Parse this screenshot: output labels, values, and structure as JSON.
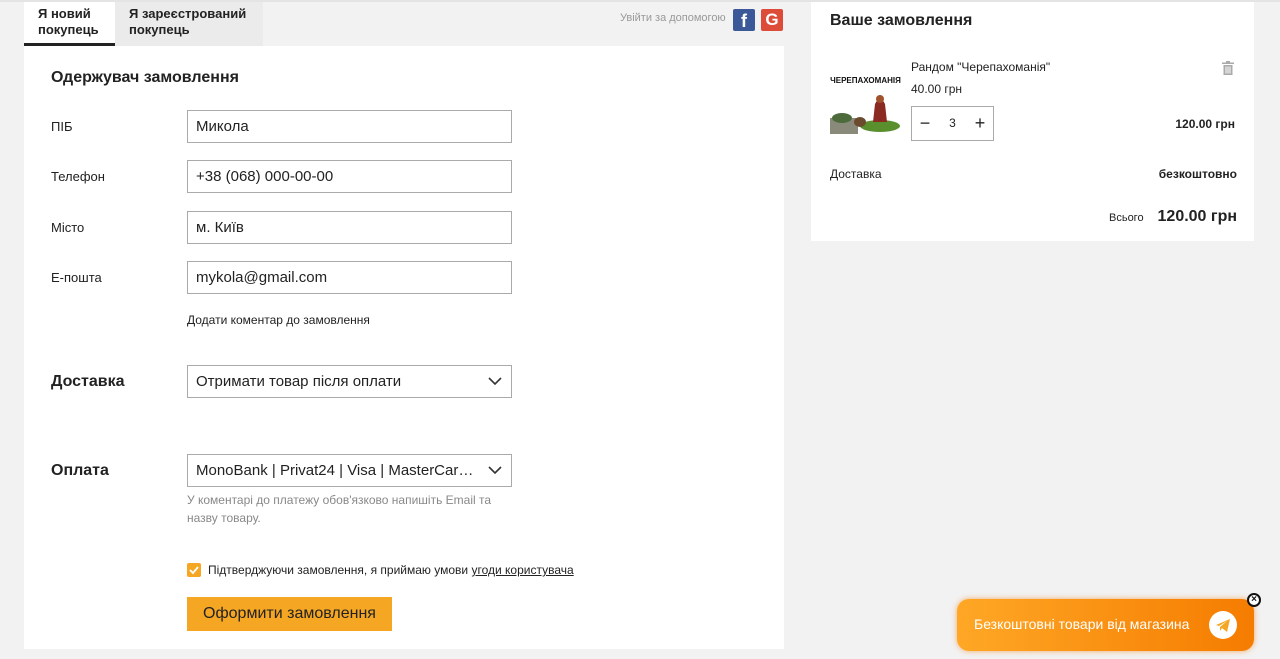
{
  "tabs": {
    "new_customer": "Я новий покупець",
    "registered": "Я зареєстрований покупець"
  },
  "social": {
    "label": "Увійти за допомогою",
    "facebook_icon": "facebook-icon",
    "google_icon": "google-icon"
  },
  "recipient": {
    "title": "Одержувач замовлення",
    "fields": [
      {
        "label": "ПІБ",
        "value": "Микола"
      },
      {
        "label": "Телефон",
        "value": "+38 (068) 000-00-00"
      },
      {
        "label": "Місто",
        "value": "м. Київ"
      },
      {
        "label": "Е-пошта",
        "value": "mykola@gmail.com"
      }
    ],
    "comment_link": "Додати коментар до замовлення"
  },
  "delivery": {
    "label": "Доставка",
    "selected": "Отримати товар після оплати"
  },
  "payment": {
    "label": "Оплата",
    "selected": "MonoBank | Privat24 | Visa | MasterCard | ...",
    "hint": "У коментарі до платежу обов'язково напишіть Email та назву товару."
  },
  "agreement": {
    "text": "Підтверджуючи замовлення, я приймаю умови ",
    "link": "угоди користувача",
    "checked": true
  },
  "submit_label": "Оформити замовлення",
  "order": {
    "title": "Ваше замовлення",
    "item": {
      "thumb_text": "ЧЕРЕПАХОМАНІЯ",
      "name": "Рандом \"Черепахоманія\"",
      "price": "40.00 грн",
      "quantity": "3",
      "line_total": "120.00 грн"
    },
    "shipping_label": "Доставка",
    "shipping_value": "безкоштовно",
    "total_label": "Всього",
    "total_value": "120.00 грн"
  },
  "promo": {
    "text": "Безкоштовні товари від магазина",
    "icon": "telegram-icon"
  },
  "colors": {
    "accent": "#f5a623",
    "facebook": "#3b5998",
    "google": "#dd4b39"
  }
}
